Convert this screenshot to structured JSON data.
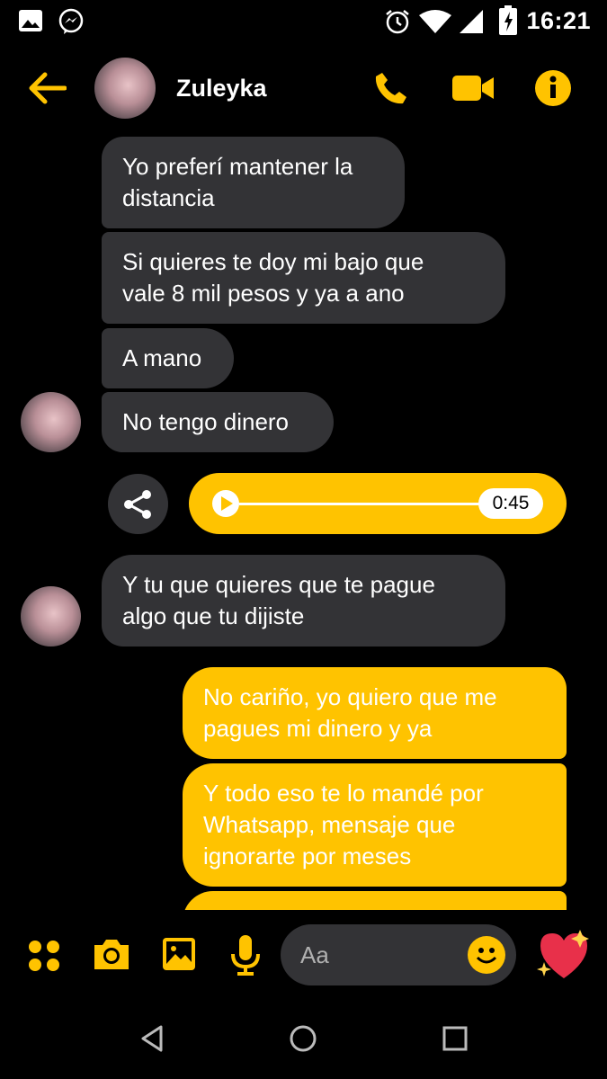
{
  "status_bar": {
    "time": "16:21"
  },
  "header": {
    "contact_name": "Zuleyka"
  },
  "messages": [
    {
      "direction": "in",
      "text": "Yo preferí mantener la\ndistancia"
    },
    {
      "direction": "in",
      "text": "Si quieres te doy mi bajo que\nvale 8 mil pesos y ya a ano"
    },
    {
      "direction": "in",
      "text": "A mano"
    },
    {
      "direction": "in",
      "text": "No tengo dinero"
    },
    {
      "direction": "in",
      "text": "Y tu que quieres que te pague\nalgo que tu dijiste"
    },
    {
      "direction": "out",
      "text": "No cariño, yo quiero que me\npagues mi dinero y ya"
    },
    {
      "direction": "out",
      "text": "Y todo eso te lo mandé por\nWhatsapp, mensaje que\nignorarte por meses"
    }
  ],
  "audio_message": {
    "duration": "0:45",
    "progress": 0.0
  },
  "composer": {
    "placeholder": "Aa"
  },
  "colors": {
    "accent": "#ffc300",
    "incoming_bubble": "#333336",
    "background": "#000000"
  },
  "icons": [
    "gallery-icon",
    "messenger-icon",
    "alarm-icon",
    "wifi-icon",
    "signal-icon",
    "battery-icon",
    "back-arrow-icon",
    "phone-icon",
    "video-camera-icon",
    "info-icon",
    "share-icon",
    "apps-icon",
    "camera-icon",
    "image-icon",
    "microphone-icon",
    "emoji-icon",
    "heart-sparkle-icon",
    "nav-back-icon",
    "nav-home-icon",
    "nav-recents-icon"
  ]
}
